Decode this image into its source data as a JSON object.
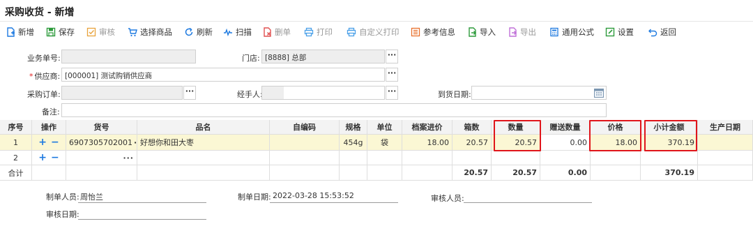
{
  "page": {
    "title": "采购收货 - 新增"
  },
  "toolbar": {
    "new": "新增",
    "save": "保存",
    "audit": "审核",
    "select_goods": "选择商品",
    "refresh": "刷新",
    "scan": "扫描",
    "delete": "删单",
    "print": "打印",
    "custom_print": "自定义打印",
    "reference": "参考信息",
    "import": "导入",
    "export": "导出",
    "formula": "通用公式",
    "settings": "设置",
    "back": "返回"
  },
  "form": {
    "order_no_label": "业务单号:",
    "store_label": "门店:",
    "store_value": "[8888] 总部",
    "supplier_req": "*",
    "supplier_label": "供应商:",
    "supplier_value": "[000001] 测试购销供应商",
    "po_label": "采购订单:",
    "handler_label": "经手人:",
    "arrival_label": "到货日期:",
    "remark_label": "备注:"
  },
  "table": {
    "headers": {
      "seq": "序号",
      "op": "操作",
      "code": "货号",
      "name": "品名",
      "selfcode": "自编码",
      "spec": "规格",
      "unit": "单位",
      "archive_price": "档案进价",
      "boxes": "箱数",
      "qty": "数量",
      "gift_qty": "赠送数量",
      "price": "价格",
      "subtotal": "小计金额",
      "prod_date": "生产日期"
    },
    "rows": [
      {
        "seq": "1",
        "code": "6907305702001",
        "name": "好想你和田大枣",
        "spec": "454g",
        "unit": "袋",
        "archive_price": "18.00",
        "boxes": "20.57",
        "qty": "20.57",
        "gift_qty": "0.00",
        "price": "18.00",
        "subtotal": "370.19"
      },
      {
        "seq": "2"
      }
    ],
    "total": {
      "label": "合计",
      "boxes": "20.57",
      "qty": "20.57",
      "gift_qty": "0.00",
      "subtotal": "370.19"
    }
  },
  "footer": {
    "maker_label": "制单人员:",
    "maker_value": "周怡兰",
    "make_date_label": "制单日期:",
    "make_date_value": "2022-03-28 15:53:52",
    "auditor_label": "审核人员:",
    "audit_date_label": "审核日期:"
  },
  "colors": {
    "accent_blue": "#1e7ae0",
    "highlight_red": "#e0151b",
    "row_selected": "#fbf7d4"
  }
}
